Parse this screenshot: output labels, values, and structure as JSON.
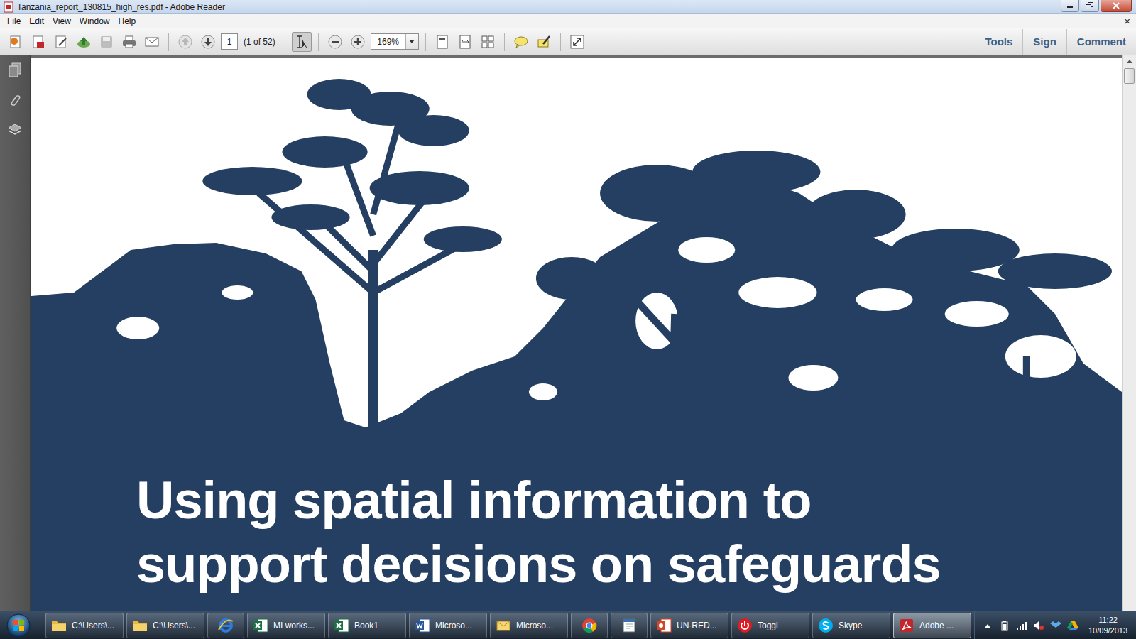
{
  "window": {
    "title": "Tanzania_report_130815_high_res.pdf - Adobe Reader"
  },
  "menu": [
    "File",
    "Edit",
    "View",
    "Window",
    "Help"
  ],
  "menu_close": "×",
  "toolbar": {
    "page": "1",
    "page_count": "(1 of 52)",
    "zoom": "169%",
    "panels": [
      "Tools",
      "Sign",
      "Comment"
    ]
  },
  "document": {
    "title_lines": [
      "Using spatial information to",
      "support decisions on safeguards"
    ]
  },
  "taskbar": {
    "items": [
      {
        "label": "C:\\Users\\...",
        "kind": "folder",
        "selected": false
      },
      {
        "label": "C:\\Users\\...",
        "kind": "folder",
        "selected": false
      },
      {
        "kind": "ie",
        "selected": false
      },
      {
        "label": "MI works...",
        "kind": "excel",
        "selected": false
      },
      {
        "label": "Book1",
        "kind": "excel",
        "selected": false
      },
      {
        "label": "Microso...",
        "kind": "word",
        "selected": false
      },
      {
        "label": "Microso...",
        "kind": "outlook",
        "selected": false
      },
      {
        "kind": "chrome",
        "selected": false
      },
      {
        "kind": "calendar",
        "selected": false
      },
      {
        "label": "UN-RED...",
        "kind": "powerpoint",
        "selected": false
      },
      {
        "label": "Toggl",
        "kind": "toggl",
        "selected": false
      },
      {
        "label": "Skype",
        "kind": "skype",
        "selected": false
      },
      {
        "label": "Adobe ...",
        "kind": "acrobat",
        "selected": true
      }
    ],
    "clock": {
      "time": "11:22",
      "date": "10/09/2013"
    }
  }
}
